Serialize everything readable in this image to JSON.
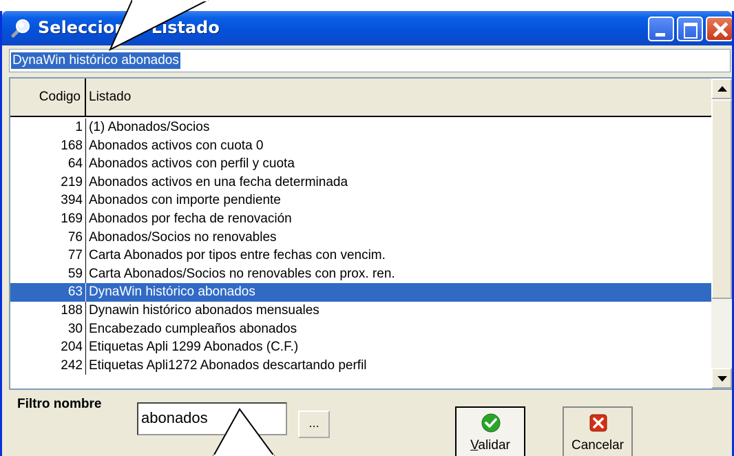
{
  "window": {
    "title": "Seleccionar Listado",
    "icon": "search-icon"
  },
  "selection_field": {
    "value": "DynaWin histórico abonados"
  },
  "grid": {
    "columns": [
      "Codigo",
      "Listado"
    ],
    "rows": [
      {
        "codigo": "1",
        "listado": "(1) Abonados/Socios"
      },
      {
        "codigo": "168",
        "listado": "Abonados activos con cuota 0"
      },
      {
        "codigo": "64",
        "listado": "Abonados activos con perfil y cuota"
      },
      {
        "codigo": "219",
        "listado": "Abonados activos en una fecha determinada"
      },
      {
        "codigo": "394",
        "listado": "Abonados con importe pendiente"
      },
      {
        "codigo": "169",
        "listado": "Abonados por fecha de renovación"
      },
      {
        "codigo": "76",
        "listado": "Abonados/Socios no renovables"
      },
      {
        "codigo": "77",
        "listado": "Carta Abonados por tipos entre fechas con vencim."
      },
      {
        "codigo": "59",
        "listado": "Carta Abonados/Socios no renovables con prox. ren."
      },
      {
        "codigo": "63",
        "listado": "DynaWin histórico abonados",
        "selected": true
      },
      {
        "codigo": "188",
        "listado": "Dynawin histórico abonados mensuales"
      },
      {
        "codigo": "30",
        "listado": "Encabezado cumpleaños abonados"
      },
      {
        "codigo": "204",
        "listado": "Etiquetas Apli 1299 Abonados (C.F.)"
      },
      {
        "codigo": "242",
        "listado": "Etiquetas Apli1272 Abonados descartando perfil"
      }
    ]
  },
  "filter": {
    "label": "Filtro nombre",
    "value": "abonados",
    "ellipsis_label": "..."
  },
  "buttons": {
    "validar": "Validar",
    "cancelar": "Cancelar"
  },
  "colors": {
    "titlebar": "#0550d8",
    "selection": "#316ac5",
    "validar_icon": "#2aa52a",
    "cancelar_icon": "#d42f14"
  }
}
